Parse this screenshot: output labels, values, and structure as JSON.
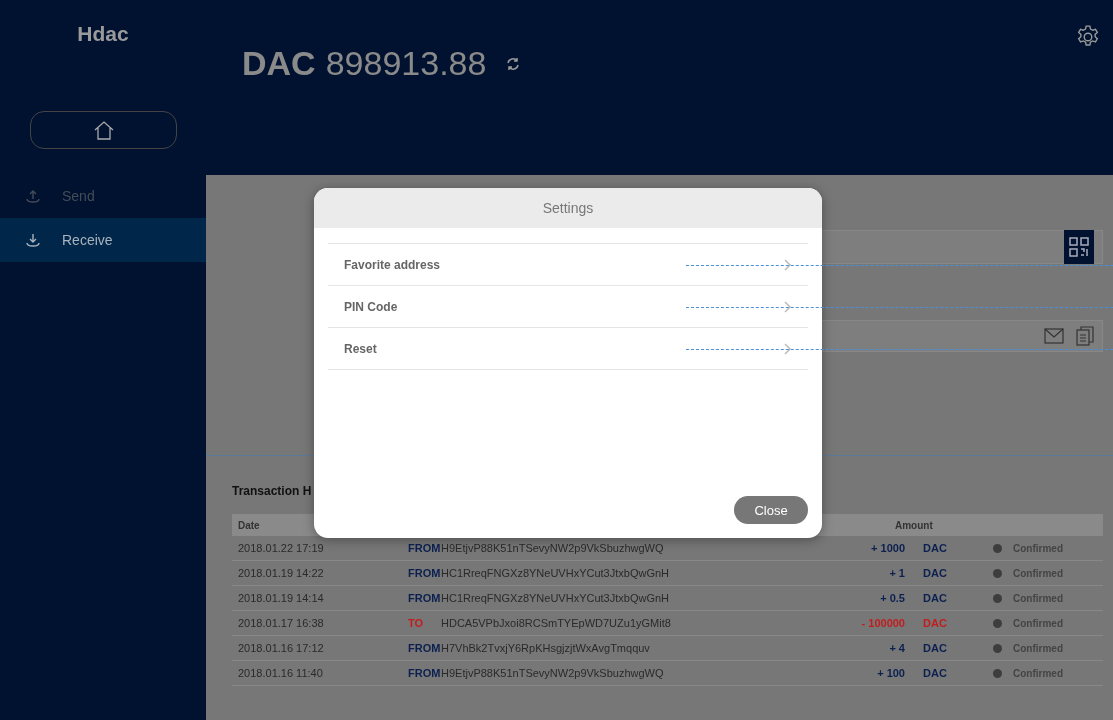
{
  "sidebar": {
    "logo": "Hdac",
    "nav": [
      {
        "kind": "upload",
        "label": "Send",
        "selected": false
      },
      {
        "kind": "download",
        "label": "Receive",
        "selected": true
      }
    ]
  },
  "balance": {
    "currency": "DAC",
    "amount": "898913.88"
  },
  "settings_dialog": {
    "title": "Settings",
    "items": [
      "Favorite address",
      "PIN Code",
      "Reset"
    ],
    "close": "Close"
  },
  "history": {
    "title": "Transaction H",
    "columns": [
      "Date",
      "Amount"
    ],
    "rows": [
      {
        "date": "2018.01.22 17:19",
        "kind": "in",
        "direction": "FROM",
        "address": "H9EtjvP88K51nTSevyNW2p9VkSbuzhwgWQ",
        "amount": "+ 1000",
        "unit": "DAC",
        "status": "Confirmed"
      },
      {
        "date": "2018.01.19 14:22",
        "kind": "in",
        "direction": "FROM",
        "address": "HC1RreqFNGXz8YNeUVHxYCut3JtxbQwGnH",
        "amount": "+ 1",
        "unit": "DAC",
        "status": "Confirmed"
      },
      {
        "date": "2018.01.19 14:14",
        "kind": "in",
        "direction": "FROM",
        "address": "HC1RreqFNGXz8YNeUVHxYCut3JtxbQwGnH",
        "amount": "+ 0.5",
        "unit": "DAC",
        "status": "Confirmed"
      },
      {
        "date": "2018.01.17 16:38",
        "kind": "out",
        "direction": "TO",
        "address": "HDCA5VPbJxoi8RCSmTYEpWD7UZu1yGMit8",
        "amount": "- 100000",
        "unit": "DAC",
        "status": "Confirmed"
      },
      {
        "date": "2018.01.16 17:12",
        "kind": "in",
        "direction": "FROM",
        "address": "H7VhBk2TvxjY6RpKHsgjzjtWxAvgTmqquv",
        "amount": "+ 4",
        "unit": "DAC",
        "status": "Confirmed"
      },
      {
        "date": "2018.01.16 11:40",
        "kind": "in",
        "direction": "FROM",
        "address": "H9EtjvP88K51nTSevyNW2p9VkSbuzhwgWQ",
        "amount": "+ 100",
        "unit": "DAC",
        "status": "Confirmed"
      }
    ]
  }
}
